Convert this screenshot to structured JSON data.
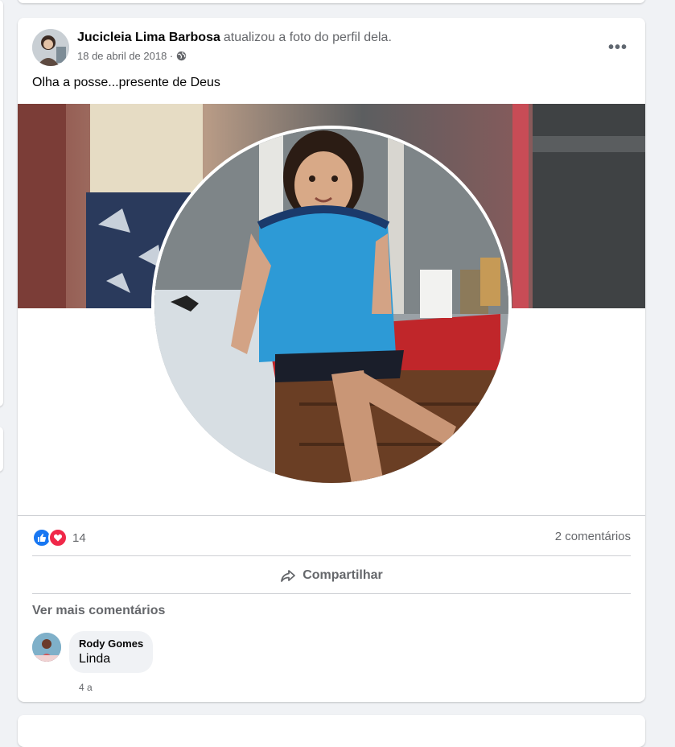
{
  "post": {
    "author": "Jucicleia Lima Barbosa",
    "action": "atualizou a foto do perfil dela.",
    "date": "18 de abril de 2018 ·",
    "privacy_icon": "globe-icon",
    "more_label": "•••",
    "text": "Olha a posse...presente de Deus"
  },
  "reactions": {
    "icons": [
      "like-icon",
      "love-icon"
    ],
    "count": "14"
  },
  "comments_count": "2 comentários",
  "actions": {
    "share_label": "Compartilhar"
  },
  "comments_section": {
    "view_more": "Ver mais comentários",
    "items": [
      {
        "author": "Rody Gomes",
        "text": "Linda",
        "time": "4 a"
      }
    ]
  },
  "colors": {
    "background": "#f0f2f5",
    "card": "#ffffff",
    "secondary_text": "#65676b",
    "like": "#1877f2",
    "love": "#f02849"
  }
}
